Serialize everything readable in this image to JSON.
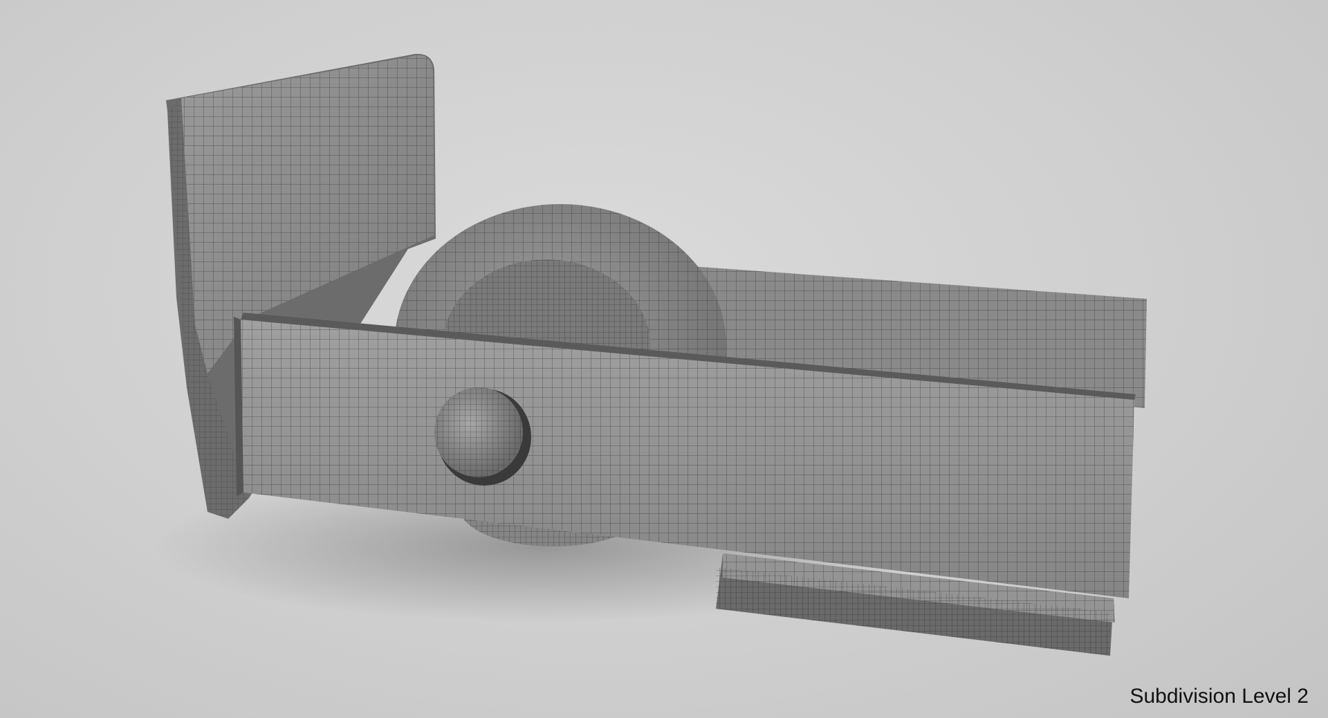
{
  "caption": "Subdivision Level 2",
  "colors": {
    "background": "#cfcfcf",
    "surface": "#8f8f8f",
    "surface_dark": "#6e6e6e",
    "wire": "#1a1a1a",
    "caption_text": "#111111"
  }
}
